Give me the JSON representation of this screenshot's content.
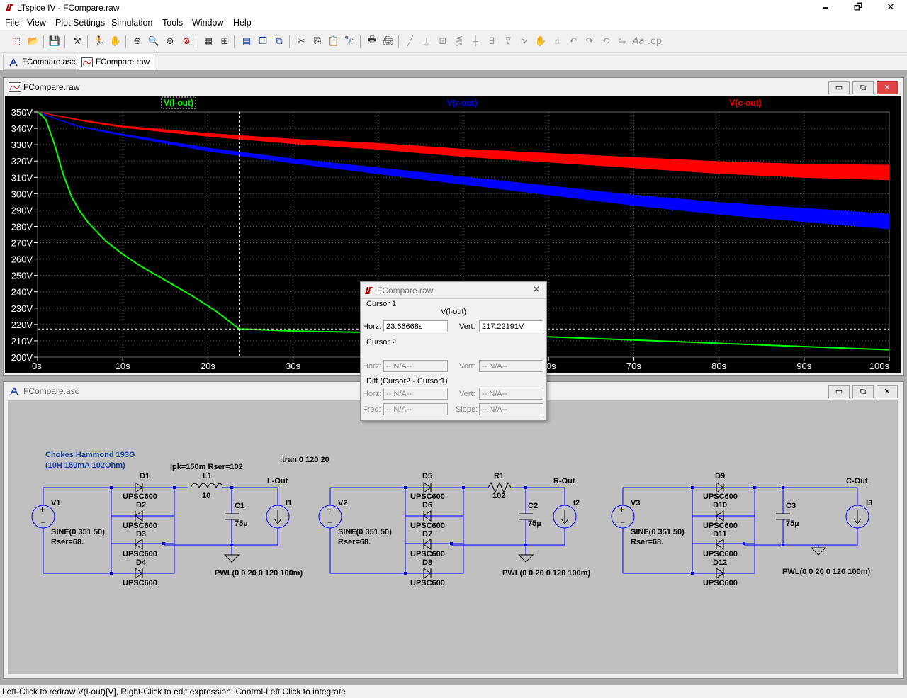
{
  "app": {
    "title": "LTspice IV - FCompare.raw",
    "minimize": "🗕",
    "restore": "🗗",
    "close": "✕"
  },
  "menu": [
    "File",
    "View",
    "Plot Settings",
    "Simulation",
    "Tools",
    "Window",
    "Help"
  ],
  "tabs": [
    {
      "label": "FCompare.asc",
      "icon": "schematic-icon"
    },
    {
      "label": "FCompare.raw",
      "icon": "waveform-icon"
    }
  ],
  "plot_window": {
    "title": "FCompare.raw",
    "traces": [
      {
        "label": "V(l-out)",
        "color": "#00ff00"
      },
      {
        "label": "V(r-out)",
        "color": "#0000ff"
      },
      {
        "label": "V(c-out)",
        "color": "#ff0000"
      }
    ],
    "colors": {
      "background": "#000000",
      "grid": "#6a6a6a",
      "axis_text": "#ffffff"
    }
  },
  "chart_data": {
    "type": "line",
    "xlabel": "",
    "ylabel": "",
    "xlim": [
      0,
      100
    ],
    "ylim": [
      200,
      350
    ],
    "x_ticks": [
      "0s",
      "10s",
      "20s",
      "30s",
      "40s",
      "50s",
      "60s",
      "70s",
      "80s",
      "90s",
      "100s"
    ],
    "y_ticks": [
      "200V",
      "210V",
      "220V",
      "230V",
      "240V",
      "250V",
      "260V",
      "270V",
      "280V",
      "290V",
      "300V",
      "310V",
      "320V",
      "330V",
      "340V",
      "350V"
    ],
    "grid": true,
    "cursor": {
      "x": 23.66668,
      "y": 217.22191
    },
    "series": [
      {
        "name": "V(l-out)",
        "color": "#00ff00",
        "x": [
          0,
          0.5,
          1,
          2,
          3,
          4,
          5,
          6,
          8,
          10,
          12,
          15,
          18,
          21,
          23.67,
          25,
          30,
          40,
          50,
          60,
          70,
          80,
          90,
          100
        ],
        "y": [
          350,
          348,
          345,
          330,
          312,
          298,
          289,
          282,
          271,
          263,
          256,
          247,
          238,
          228,
          217.2,
          217,
          216,
          215,
          214,
          212.5,
          210.5,
          208.5,
          206.5,
          204.5
        ],
        "band": 0.6
      },
      {
        "name": "V(r-out)",
        "color": "#0000ff",
        "x": [
          0,
          2,
          5,
          10,
          20,
          30,
          40,
          50,
          60,
          70,
          80,
          90,
          100
        ],
        "y": [
          350,
          346,
          341,
          336,
          327,
          320,
          314,
          308,
          302,
          296,
          291,
          287,
          283
        ],
        "band_end": 4.5
      },
      {
        "name": "V(c-out)",
        "color": "#ff0000",
        "x": [
          0,
          2,
          5,
          10,
          20,
          30,
          40,
          50,
          60,
          70,
          80,
          90,
          100
        ],
        "y": [
          350,
          348,
          345,
          341,
          336,
          332,
          329,
          325,
          322,
          319,
          316,
          314,
          313
        ],
        "band_end": 4.5
      }
    ]
  },
  "cursor_dialog": {
    "title": "FCompare.raw",
    "cursor1_label": "Cursor 1",
    "trace": "V(l-out)",
    "horz_label": "Horz:",
    "horz_value": "23.66668s",
    "vert_label": "Vert:",
    "vert_value": "217.22191V",
    "cursor2_label": "Cursor 2",
    "c2_horz": "-- N/A--",
    "c2_vert": "-- N/A--",
    "diff_label": "Diff (Cursor2 - Cursor1)",
    "diff_horz": "-- N/A--",
    "diff_vert": "-- N/A--",
    "freq_label": "Freq:",
    "freq_value": "-- N/A--",
    "slope_label": "Slope:",
    "slope_value": "-- N/A--"
  },
  "schematic_window": {
    "title": "FCompare.asc",
    "wire_color": "#0000ff",
    "text": {
      "chokes_title": "Chokes Hammond 193G",
      "chokes_sub": "(10H 150mA 102Ohm)",
      "tran": ".tran 0 120 20",
      "l1_params": "Ipk=150m Rser=102",
      "l1": "L1",
      "l1_val": "10",
      "lout": "L-Out",
      "rout": "R-Out",
      "cout": "C-Out",
      "r1": "R1",
      "r1_val": "102",
      "v1": "V1",
      "v2": "V2",
      "v3": "V3",
      "sine": "SINE(0 351 50)",
      "rser": "Rser=68.",
      "c1": "C1",
      "c2": "C2",
      "c3": "C3",
      "cap_val": "75µ",
      "i1": "I1",
      "i2": "I2",
      "i3": "I3",
      "pwl": "PWL(0 0 20 0 120 100m)",
      "diode_model": "UPSC600",
      "d": [
        "D1",
        "D2",
        "D3",
        "D4",
        "D5",
        "D6",
        "D7",
        "D8",
        "D9",
        "D10",
        "D11",
        "D12"
      ]
    }
  },
  "status": "Left-Click to redraw V(l-out)[V],  Right-Click to edit expression. Control-Left Click to integrate"
}
